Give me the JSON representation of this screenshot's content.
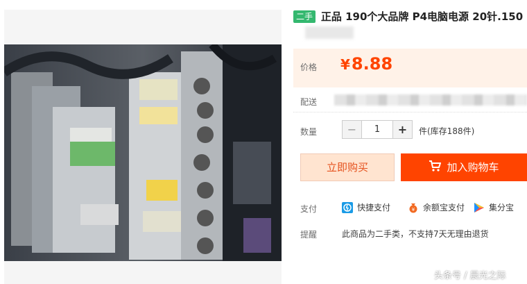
{
  "product": {
    "tag": "二手",
    "title": "正品 190个大品牌 P4电脑电源 20针.150"
  },
  "price": {
    "label": "价格",
    "currency": "¥",
    "value": "8.88"
  },
  "shipping": {
    "label": "配送"
  },
  "quantity": {
    "label": "数量",
    "minus": "−",
    "value": "1",
    "plus": "+",
    "stock": "件(库存188件)"
  },
  "actions": {
    "buy_now": "立即购买",
    "add_to_cart": "加入购物车"
  },
  "payment": {
    "label": "支付",
    "methods": [
      {
        "name": "快捷支付",
        "icon": "quick-pay-icon"
      },
      {
        "name": "余额宝支付",
        "icon": "yuebao-icon"
      },
      {
        "name": "集分宝",
        "icon": "jifenbao-icon"
      }
    ]
  },
  "notice": {
    "label": "提醒",
    "text": "此商品为二手类，不支持7天无理由退货"
  },
  "watermark": "头条号 / 晨光之际",
  "colors": {
    "accent": "#ff4400",
    "price_bg": "#fff2e8",
    "tag_green": "#34b86f"
  }
}
